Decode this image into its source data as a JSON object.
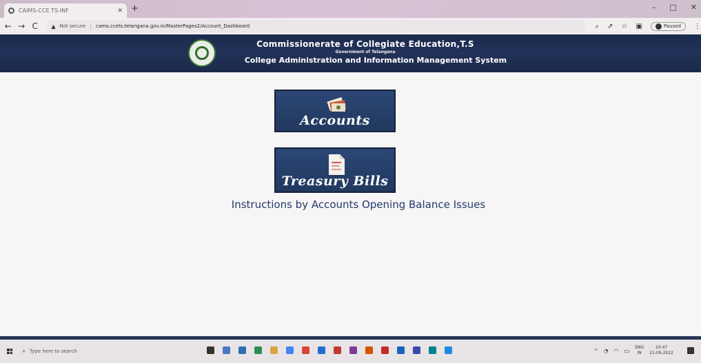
{
  "browser": {
    "tab_title": "CAIMS-CCE TS-INF",
    "new_tab": "+",
    "window_controls": {
      "minimize": "–",
      "maximize": "□",
      "close": "✕"
    },
    "nav": {
      "back": "←",
      "forward": "→",
      "reload": "C"
    },
    "not_secure_label": "Not secure",
    "url": "cams.ccets.telangana.gov.in/MasterPages2/Account_Dashboard",
    "profile_label": "Paused"
  },
  "header": {
    "title": "Commissionerate of Collegiate Education,T.S",
    "subtitle": "Government of Telangana",
    "system_name": "College Administration and Information Management System"
  },
  "tiles": [
    {
      "label": "Accounts",
      "icon": "money-icon"
    },
    {
      "label": "Treasury Bills",
      "icon": "document-icon"
    }
  ],
  "instructions_link": "Instructions by Accounts Opening Balance Issues",
  "taskbar": {
    "search_placeholder": "Type here to search",
    "apps": [
      "#333333",
      "#4a78c2",
      "#2f6fb0",
      "#2e8b57",
      "#d9a441",
      "#4285f4",
      "#db4437",
      "#1f6fd1",
      "#c0392b",
      "#7d3c98",
      "#d35400",
      "#c62828",
      "#1565c0",
      "#3949ab",
      "#00838f",
      "#1e88e5"
    ],
    "language": "ENG",
    "language_region": "IN",
    "time": "10:47",
    "date": "21-09-2022"
  }
}
